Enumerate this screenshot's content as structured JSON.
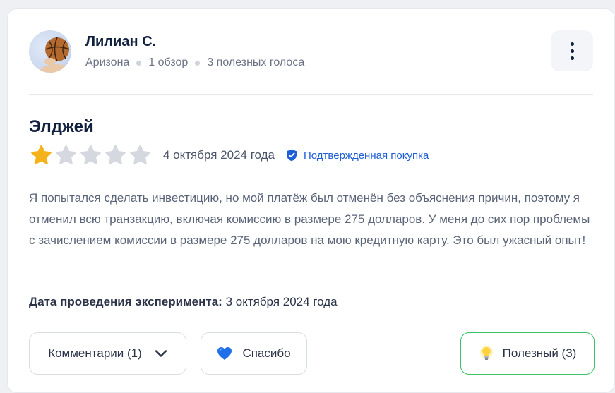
{
  "review": {
    "author": {
      "name": "Лилиан С.",
      "location": "Аризона",
      "reviews_count": "1 обзор",
      "helpful_votes": "3 полезных голоса",
      "avatar_icon": "basketball-avatar"
    },
    "title": "Элджей",
    "rating": 1,
    "max_rating": 5,
    "date": "4 октября 2024 года",
    "verified_label": "Подтвержденная покупка",
    "body": "Я попытался сделать инвестицию, но мой платёж был отменён без объяснения причин, поэтому я отменил всю транзакцию, включая комиссию в размере 275 долларов. У меня до сих пор проблемы с зачислением комиссии в размере 275 долларов на мою кредитную карту. Это был ужасный опыт!",
    "experiment_label": "Дата проведения эксперимента:",
    "experiment_date": "3 октября 2024 года"
  },
  "actions": {
    "comments_label": "Комментарии (1)",
    "thanks_label": "Спасибо",
    "useful_label": "Полезный (3)"
  },
  "colors": {
    "star_filled": "#f5b31b",
    "star_empty": "#d5d8de",
    "verified": "#1f5fd6",
    "useful_border": "#3cc16a",
    "heart": "#1e6fe8"
  }
}
